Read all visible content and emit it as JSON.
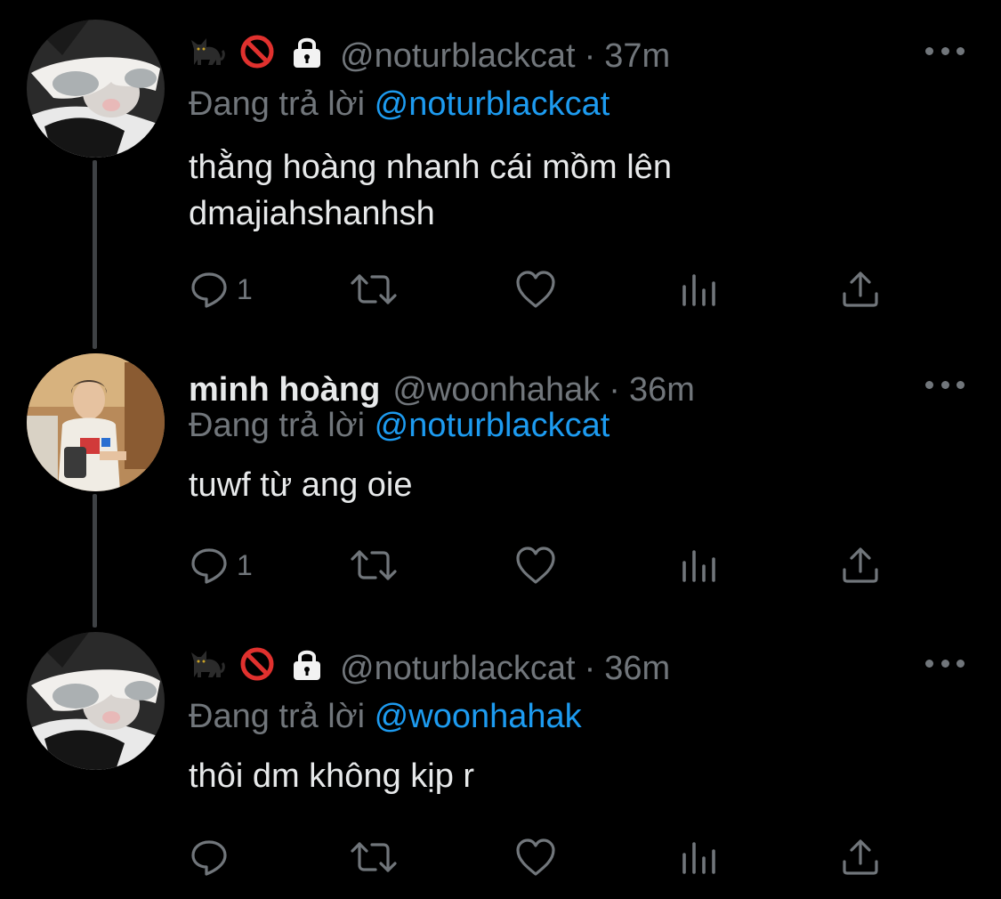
{
  "colors": {
    "background": "#000000",
    "text": "#e7e9ea",
    "muted": "#71767b",
    "link": "#1d9bf0",
    "thread_line": "#3e4144"
  },
  "tweets": [
    {
      "emoji": [
        "cat-emoji",
        "prohibited-emoji",
        "lock-emoji"
      ],
      "display_name": "",
      "handle": "@noturblackcat",
      "separator": "·",
      "time": "37m",
      "reply_prefix": "Đang trả lời",
      "reply_to": "@noturblackcat",
      "text": "thằng hoàng nhanh cái mồm lên\ndmajiahshanhsh",
      "reply_count": "1",
      "retweet_count": "",
      "like_count": ""
    },
    {
      "emoji": [],
      "display_name": "minh hoàng",
      "handle": "@woonhahak",
      "separator": "·",
      "time": "36m",
      "reply_prefix": "Đang trả lời",
      "reply_to": "@noturblackcat",
      "text": "tuwf từ ang oie",
      "reply_count": "1",
      "retweet_count": "",
      "like_count": ""
    },
    {
      "emoji": [
        "cat-emoji",
        "prohibited-emoji",
        "lock-emoji"
      ],
      "display_name": "",
      "handle": "@noturblackcat",
      "separator": "·",
      "time": "36m",
      "reply_prefix": "Đang trả lời",
      "reply_to": "@woonhahak",
      "text": "thôi dm không kịp r",
      "reply_count": "",
      "retweet_count": "",
      "like_count": ""
    }
  ]
}
